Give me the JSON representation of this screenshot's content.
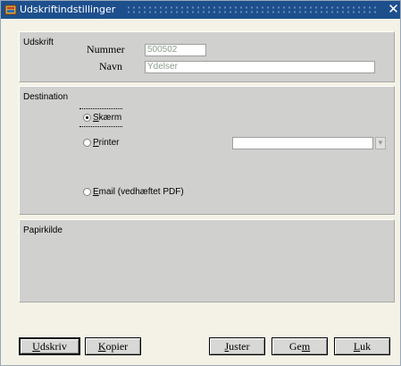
{
  "window": {
    "title": "Udskriftindstillinger",
    "close_glyph": "✕",
    "icon": "oracle-forms-app-icon"
  },
  "udskrift": {
    "section_label": "Udskrift",
    "nummer_label": "Nummer",
    "nummer_value": "500502",
    "navn_label": "Navn",
    "navn_value": "Ydelser"
  },
  "destination": {
    "section_label": "Destination",
    "options": [
      {
        "label": "Skærm",
        "mnemonic": "S",
        "rest": "kærm",
        "selected": true
      },
      {
        "label": "Printer",
        "mnemonic": "P",
        "rest": "rinter",
        "selected": false
      },
      {
        "label": "Email (vedhæftet PDF)",
        "mnemonic": "E",
        "rest": "mail (vedhæftet PDF)",
        "selected": false
      }
    ],
    "printer_value": "",
    "printer_dropdown_icon": "dropdown-arrow-icon"
  },
  "papirkilde": {
    "section_label": "Papirkilde"
  },
  "buttons": {
    "udskriv": {
      "label": "Udskriv",
      "mnemonic": "U",
      "rest": "dskriv"
    },
    "kopier": {
      "label": "Kopier",
      "mnemonic": "K",
      "rest": "opier"
    },
    "juster": {
      "label": "Juster",
      "mnemonic": "J",
      "rest": "uster"
    },
    "gem": {
      "label": "Gem",
      "before": "Ge",
      "mnemonic": "m"
    },
    "luk": {
      "label": "Luk",
      "mnemonic": "L",
      "rest": "uk"
    }
  },
  "colors": {
    "titlebar": "#1d4f8d",
    "panel": "#d0d0ce",
    "window_bg": "#f4f2e6"
  }
}
